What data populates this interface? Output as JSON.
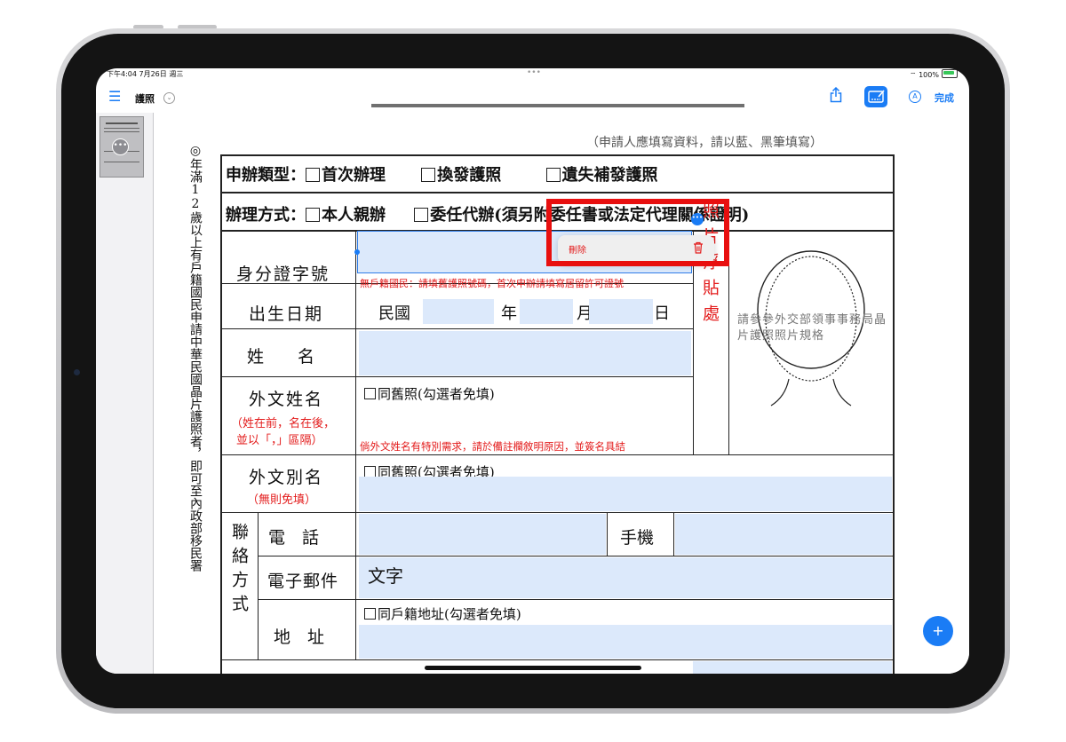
{
  "status": {
    "time_date": "下午4:04  7月26日 週三",
    "battery": "100%"
  },
  "nav": {
    "title": "護照"
  },
  "toolbar": {
    "done_label": "完成"
  },
  "context_menu": {
    "delete_label": "刪除"
  },
  "form": {
    "instruction": "（申請人應填寫資料，請以藍、黑筆填寫）",
    "side_note": "◎年滿12歲以上有戶籍國民申請中華民國晶片護照者，即可至內政部移民署",
    "apply_type": {
      "label": "申辦類型：",
      "opt1": "首次辦理",
      "opt2": "換發護照",
      "opt3": "遺失補發護照"
    },
    "apply_method": {
      "label": "辦理方式：",
      "opt1": "本人親辦",
      "opt2": "委任代辦(須另附委任書或法定代理關係證明)"
    },
    "id_label": "身分證字號",
    "id_note": "無戶籍國民：請填舊護照號碼，首次申辦請填寫居留許可證號",
    "dob": {
      "label": "出生日期",
      "era": "民國",
      "year": "年",
      "month": "月",
      "day": "日"
    },
    "name_label": "姓　　名",
    "foreign_name": {
      "label": "外文姓名",
      "note1": "（姓在前，名在後，",
      "note2": "並以「，」區隔）",
      "same_label": "同舊照(勾選者免填)",
      "footnote": "倘外文姓名有特別需求，請於備註欄敘明原因，並簽名具結"
    },
    "alias": {
      "label": "外文別名",
      "note": "（無則免填）",
      "same_label": "同舊照(勾選者免填)"
    },
    "contact": {
      "label": "聯絡方式",
      "phone_label": "電　話",
      "mobile_label": "手機",
      "email_label": "電子郵件",
      "email_value": "文字",
      "address_label": "地　址",
      "address_same": "同戶籍地址(勾選者免填)"
    },
    "photo": {
      "label": "照片浮貼處",
      "ref": "請參參外交部領事事務局晶片護照照片規格"
    }
  }
}
